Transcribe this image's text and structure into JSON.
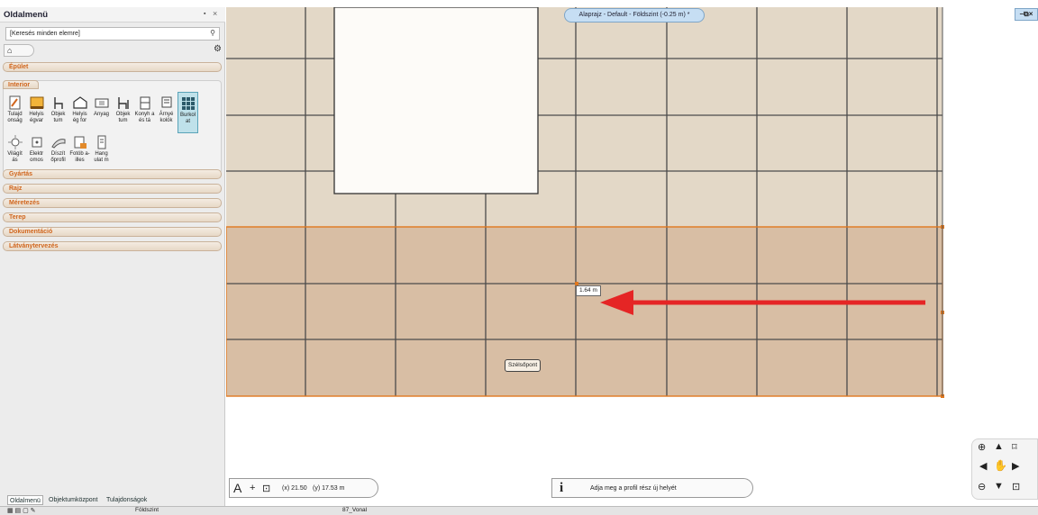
{
  "sidebar": {
    "title": "Oldalmenü",
    "search_value": "[Keresés minden elemre]",
    "categories": [
      "Épület",
      "Gyártás",
      "Rajz",
      "Méretezés",
      "Terep",
      "Dokumentáció",
      "Látványtervezés"
    ],
    "interior_label": "Interior",
    "tools_row1": [
      {
        "label": "Tulajd onság",
        "icon": "properties-icon"
      },
      {
        "label": "Helyis égvar",
        "icon": "room-icon"
      },
      {
        "label": "Objek tum",
        "icon": "object-chair-icon"
      },
      {
        "label": "Helyis ég for",
        "icon": "room-shape-icon"
      },
      {
        "label": "Anyag",
        "icon": "material-icon"
      },
      {
        "label": "Objek tum",
        "icon": "object-icon"
      },
      {
        "label": "Konyh a és tá",
        "icon": "kitchen-icon"
      },
      {
        "label": "Árnyé kolók",
        "icon": "shade-icon"
      },
      {
        "label": "Burkol at",
        "icon": "tiling-icon"
      }
    ],
    "tools_row2": [
      {
        "label": "Világít ás",
        "icon": "lighting-icon"
      },
      {
        "label": "Elektr omos",
        "icon": "electric-icon"
      },
      {
        "label": "Díszít őprofil",
        "icon": "moulding-icon"
      },
      {
        "label": "Fotób a-illes",
        "icon": "photo-icon"
      },
      {
        "label": "Hang ulat m",
        "icon": "mood-icon"
      }
    ],
    "bottom_tabs": [
      "Oldalmenü",
      "Objektumközpont",
      "Tulajdonságok"
    ]
  },
  "view": {
    "tab_title": "Alaprajz - Default - Földszint (-0.25 m) *",
    "dimension_label": "1.64 m",
    "snap_tooltip": "Szélsőpont"
  },
  "status": {
    "x_coord": "(x) 21.50",
    "y_coord": "(y) 17.53 m",
    "hint": "Adja meg a profil rész új helyét"
  },
  "toolbar": {
    "floor": "Földszint",
    "line_type": "87_Vonal"
  },
  "colors": {
    "accent_orange": "#d0651c",
    "arrow_red": "#e52525",
    "tile_upper": "#e3d8c7",
    "tile_lower": "#d8bea4"
  }
}
